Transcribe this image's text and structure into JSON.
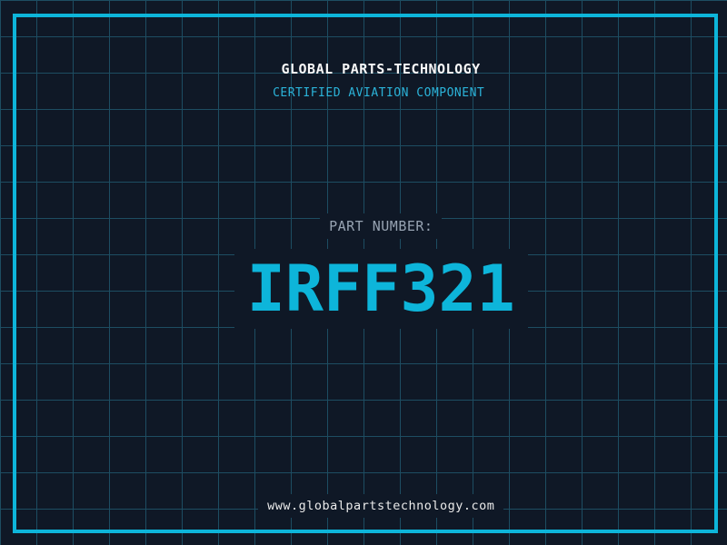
{
  "header": {
    "company_name": "GLOBAL PARTS-TECHNOLOGY",
    "tagline": "CERTIFIED AVIATION COMPONENT"
  },
  "part": {
    "label": "PART NUMBER:",
    "number": "IRFF321"
  },
  "footer": {
    "website": "www.globalpartstechnology.com"
  },
  "colors": {
    "background": "#0f1826",
    "grid-line": "#1d4d62",
    "accent-cyan": "#0db5da",
    "tagline-cyan": "#2bb3d9",
    "label-gray": "#97a3b2",
    "title-white": "#f8f8f8",
    "url-white": "#eaeaea"
  }
}
